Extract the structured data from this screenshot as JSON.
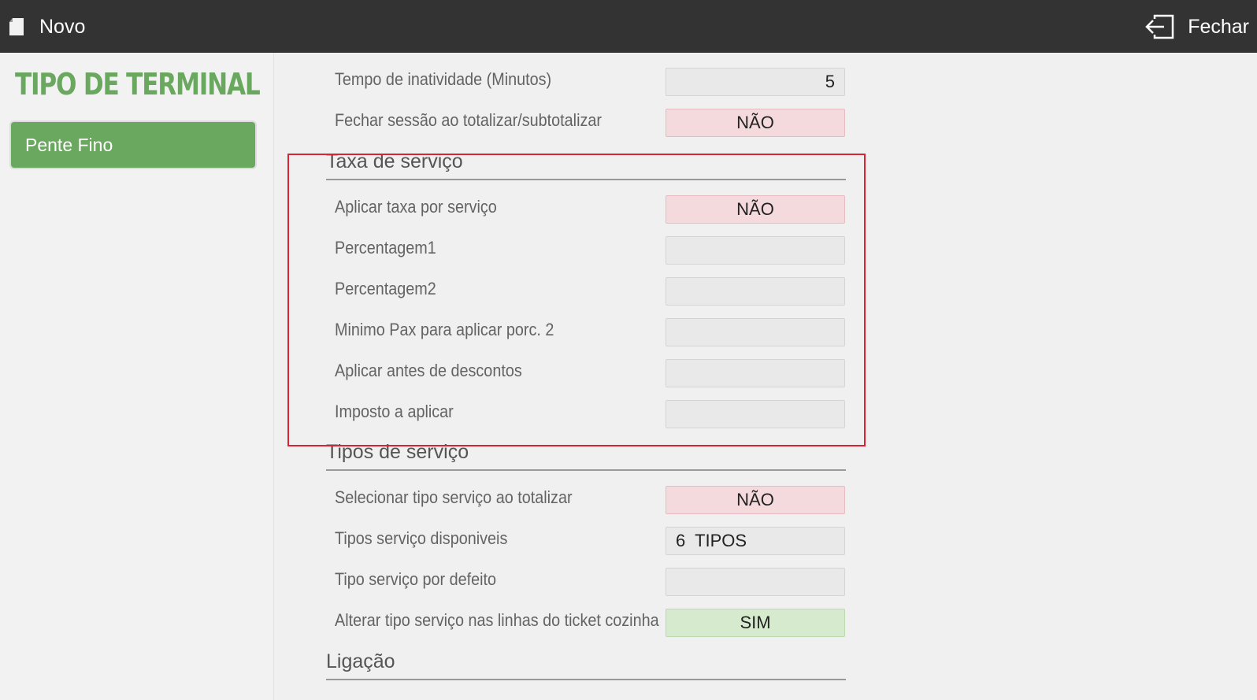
{
  "topbar": {
    "new_label": "Novo",
    "close_label": "Fechar"
  },
  "sidebar": {
    "title": "TIPO DE TERMINAL",
    "items": [
      {
        "label": "Pente Fino"
      }
    ]
  },
  "form": {
    "rows_top": [
      {
        "label": "Tempo de inatividade (Minutos)",
        "value": "5"
      },
      {
        "label": "Fechar sessão ao totalizar/subtotalizar",
        "value": "NÃO"
      }
    ],
    "sections": [
      {
        "title": "Taxa de serviço",
        "rows": [
          {
            "label": "Aplicar taxa por serviço",
            "value": "NÃO"
          },
          {
            "label": "Percentagem1",
            "value": ""
          },
          {
            "label": "Percentagem2",
            "value": ""
          },
          {
            "label": "Minimo Pax para aplicar porc. 2",
            "value": ""
          },
          {
            "label": "Aplicar antes de descontos",
            "value": ""
          },
          {
            "label": "Imposto a aplicar",
            "value": ""
          }
        ]
      },
      {
        "title": "Tipos de serviço",
        "rows": [
          {
            "label": "Selecionar tipo serviço ao totalizar",
            "value": "NÃO"
          },
          {
            "label": "Tipos serviço disponiveis",
            "value": "6  TIPOS"
          },
          {
            "label": "Tipo serviço por defeito",
            "value": ""
          },
          {
            "label": "Alterar tipo serviço nas linhas do ticket cozinha",
            "value": "SIM"
          }
        ]
      },
      {
        "title": "Ligação",
        "rows": []
      }
    ]
  },
  "colors": {
    "topbar": "#333333",
    "accent_green": "#6aa85f",
    "toggle_no": "#f5dadd",
    "toggle_yes": "#d6eacd",
    "highlight_border": "#dd2233"
  },
  "icons": {
    "new": "document-icon",
    "close": "exit-icon"
  }
}
